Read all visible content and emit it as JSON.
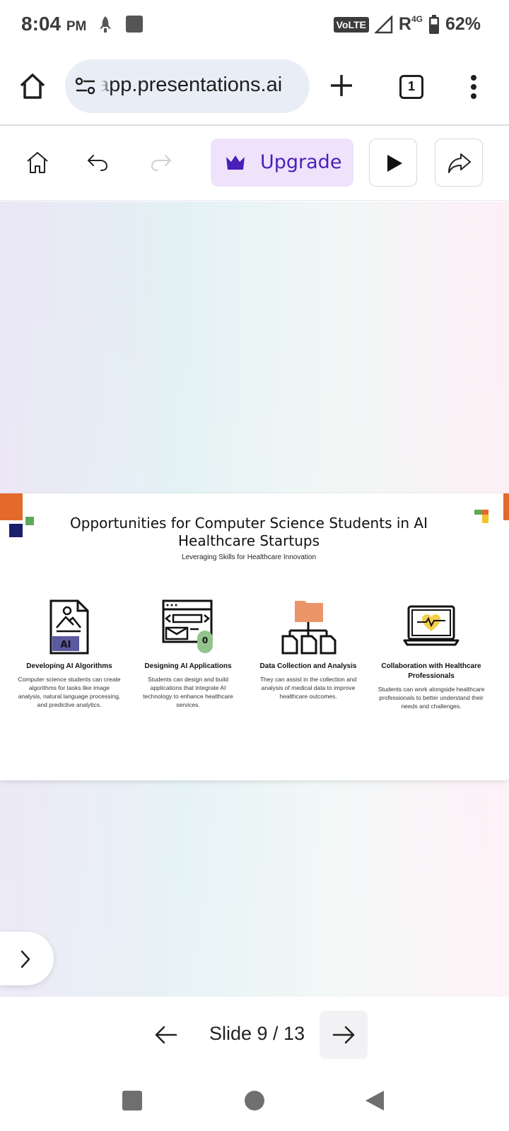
{
  "status_bar": {
    "time": "8:04",
    "ampm": "PM",
    "volte": "VoLTE",
    "roaming": "R",
    "network": "4G",
    "battery": "62%"
  },
  "browser": {
    "url": "app.presentations.ai",
    "tab_count": "1"
  },
  "toolbar": {
    "upgrade_label": "Upgrade"
  },
  "slide": {
    "title": "Opportunities for Computer Science Students in AI Healthcare Startups",
    "subtitle": "Leveraging Skills for Healthcare Innovation",
    "features": [
      {
        "title": "Developing AI Algorithms",
        "description": "Computer science students can create algorithms for tasks like image analysis, natural language processing, and predictive analytics.",
        "icon_badge": "AI"
      },
      {
        "title": "Designing AI Applications",
        "description": "Students can design and build applications that integrate AI technology to enhance healthcare services.",
        "icon_badge": "0"
      },
      {
        "title": "Data Collection and Analysis",
        "description": "They can assist in the collection and analysis of medical data to improve healthcare outcomes."
      },
      {
        "title": "Collaboration with Healthcare Professionals",
        "description": "Students can work alongside healthcare professionals to better understand their needs and challenges."
      }
    ]
  },
  "slide_nav": {
    "counter": "Slide 9 / 13"
  },
  "colors": {
    "accent": "#4a1fb8",
    "upgrade_bg": "#efe2fb",
    "orange": "#e36a2a",
    "navy": "#1a1f6b",
    "green": "#5fa85a"
  }
}
